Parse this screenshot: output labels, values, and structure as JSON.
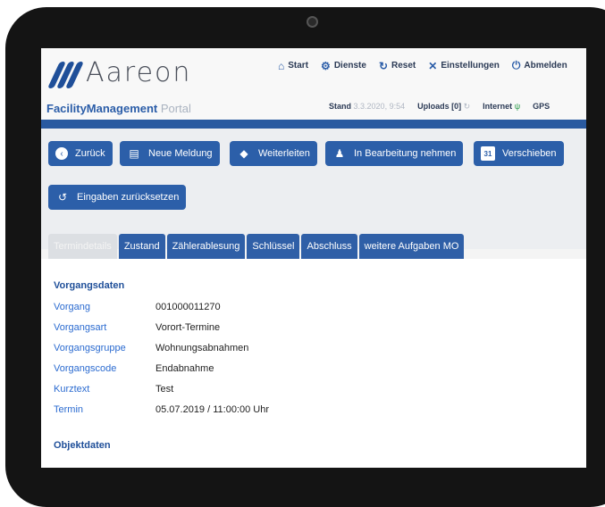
{
  "app": {
    "brand": "Aareon",
    "portal_bold": "FacilityManagement",
    "portal_light": "Portal"
  },
  "nav": [
    {
      "label": "Start",
      "icon": "home-icon"
    },
    {
      "label": "Dienste",
      "icon": "gears-icon"
    },
    {
      "label": "Reset",
      "icon": "reset-icon"
    },
    {
      "label": "Einstellungen",
      "icon": "tools-icon"
    },
    {
      "label": "Abmelden",
      "icon": "power-icon"
    }
  ],
  "status": {
    "stand_label": "Stand",
    "stand_value": "3.3.2020, 9:54",
    "uploads": "Uploads [0]",
    "internet": "Internet",
    "gps": "GPS"
  },
  "buttons": [
    {
      "label": "Zurück",
      "icon": "back-arrow-icon"
    },
    {
      "label": "Neue Meldung",
      "icon": "new-report-icon"
    },
    {
      "label": "Weiterleiten",
      "icon": "forward-icon"
    },
    {
      "label": "In Bearbeitung nehmen",
      "icon": "worker-icon"
    },
    {
      "label": "Verschieben",
      "icon": "calendar-icon"
    },
    {
      "label": "Eingaben zurücksetzen",
      "icon": "undo-icon"
    }
  ],
  "tabs": [
    {
      "label": "Termindetails",
      "active": true
    },
    {
      "label": "Zustand"
    },
    {
      "label": "Zählerablesung"
    },
    {
      "label": "Schlüssel"
    },
    {
      "label": "Abschluss"
    },
    {
      "label": "weitere Aufgaben MO"
    }
  ],
  "vorgangsdaten": {
    "title": "Vorgangsdaten",
    "rows": [
      {
        "key": "Vorgang",
        "value": "001000011270"
      },
      {
        "key": "Vorgangsart",
        "value": "Vorort-Termine"
      },
      {
        "key": "Vorgangsgruppe",
        "value": "Wohnungsabnahmen"
      },
      {
        "key": "Vorgangscode",
        "value": "Endabnahme"
      },
      {
        "key": "Kurztext",
        "value": "Test"
      },
      {
        "key": "Termin",
        "value": "05.07.2019 / 11:00:00 Uhr"
      }
    ]
  },
  "objektdaten": {
    "title": "Objektdaten"
  },
  "colors": {
    "accent": "#2c5fa9",
    "label_blue": "#2b6bd0"
  }
}
